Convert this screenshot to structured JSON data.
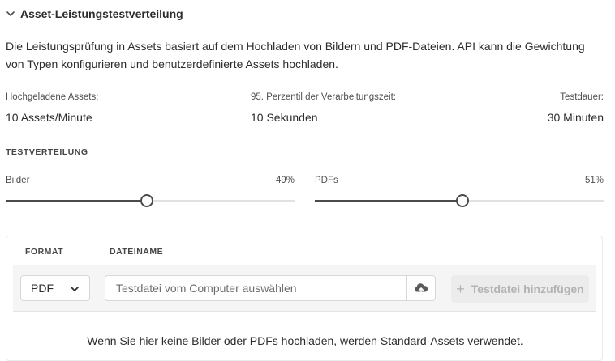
{
  "section": {
    "title": "Asset-Leistungstestverteilung",
    "description": "Die Leistungsprüfung in Assets basiert auf dem Hochladen von Bildern und PDF-Dateien. API kann die Gewichtung von Typen konfigurieren und benutzerdefinierte Assets hochladen."
  },
  "metrics": [
    {
      "label": "Hochgeladene Assets:",
      "value": "10 Assets/Minute"
    },
    {
      "label": "95. Perzentil der Verarbeitungszeit:",
      "value": "10 Sekunden"
    },
    {
      "label": "Testdauer:",
      "value": "30 Minuten"
    }
  ],
  "distribution": {
    "heading": "TESTVERTEILUNG",
    "sliders": [
      {
        "label": "Bilder",
        "value_text": "49%",
        "fraction": 0.49
      },
      {
        "label": "PDFs",
        "value_text": "51%",
        "fraction": 0.51
      }
    ]
  },
  "upload_table": {
    "headers": {
      "format": "FORMAT",
      "filename": "DATEINAME"
    },
    "format_selected": "PDF",
    "file_placeholder": "Testdatei vom Computer auswählen",
    "add_button": "Testdatei hinzufügen",
    "footnote": "Wenn Sie hier keine Bilder oder PDFs hochladen, werden Standard-Assets verwendet."
  },
  "colors": {
    "text": "#2c2c2c",
    "slider_active": "#4b4b4b",
    "slider_track": "#e1e1e1",
    "disabled": "#b3b3b3"
  },
  "icons": {
    "section_toggle": "chevron-down-icon",
    "select": "chevron-down-icon",
    "upload": "cloud-upload-icon",
    "add": "plus-icon"
  }
}
